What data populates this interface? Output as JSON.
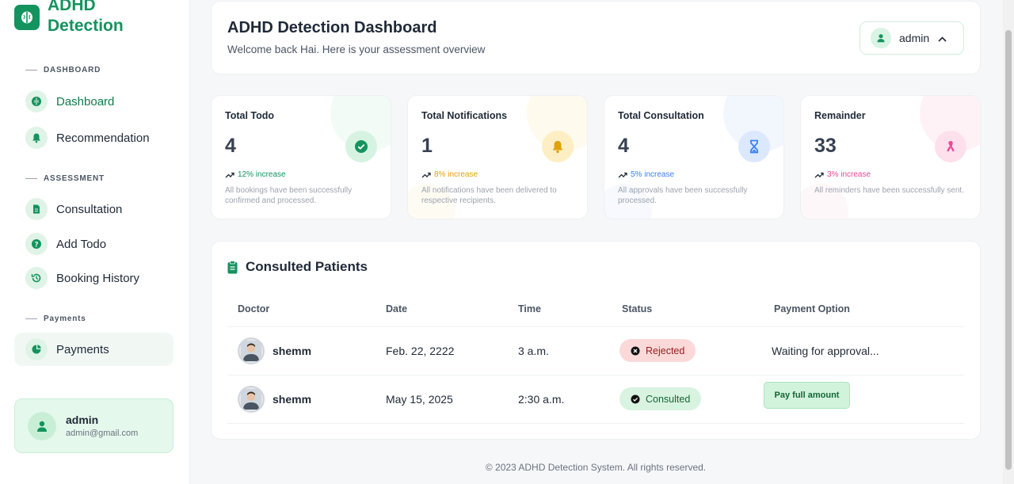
{
  "brand": {
    "line1": "ADHD",
    "line2": "Detection"
  },
  "sidebar": {
    "sections": [
      {
        "title": "DASHBOARD"
      },
      {
        "title": "ASSESSMENT"
      },
      {
        "title": "Payments"
      }
    ],
    "items": [
      {
        "label": "Dashboard",
        "icon": "brain-icon"
      },
      {
        "label": "Recommendation",
        "icon": "bell-icon"
      },
      {
        "label": "Consultation",
        "icon": "document-icon"
      },
      {
        "label": "Add Todo",
        "icon": "question-icon"
      },
      {
        "label": "Booking History",
        "icon": "history-icon"
      },
      {
        "label": "Payments",
        "icon": "pie-chart-icon"
      }
    ],
    "user": {
      "name": "admin",
      "email": "admin@gmail.com"
    }
  },
  "header": {
    "title": "ADHD Detection Dashboard",
    "subtitle": "Welcome back Hai. Here is your assessment overview",
    "user_button": "admin"
  },
  "stats": [
    {
      "label": "Total Todo",
      "value": "4",
      "trend": "12% increase",
      "desc": "All bookings have been successfully confirmed and processed.",
      "color": "#15935f",
      "icon": "check-circle-icon"
    },
    {
      "label": "Total Notifications",
      "value": "1",
      "trend": "8% increase",
      "desc": "All notifications have been delivered to respective recipients.",
      "color": "#e0a10b",
      "icon": "bell-icon"
    },
    {
      "label": "Total Consultation",
      "value": "4",
      "trend": "5% increase",
      "desc": "All approvals have been successfully processed.",
      "color": "#3b82f6",
      "icon": "hourglass-icon"
    },
    {
      "label": "Remainder",
      "value": "33",
      "trend": "3% increase",
      "desc": "All reminders have been successfully sent.",
      "color": "#ec4899",
      "icon": "ribbon-icon"
    }
  ],
  "patients": {
    "title": "Consulted Patients",
    "columns": [
      "Doctor",
      "Date",
      "Time",
      "Status",
      "Payment Option"
    ],
    "rows": [
      {
        "doctor": "shemm",
        "date": "Feb. 22, 2222",
        "time": "3 a.m.",
        "status": "Rejected",
        "payment": "Waiting for approval..."
      },
      {
        "doctor": "shemm",
        "date": "May 15, 2025",
        "time": "2:30 a.m.",
        "status": "Consulted",
        "payment": "Pay full amount"
      }
    ]
  },
  "footer": "© 2023 ADHD Detection System. All rights reserved."
}
